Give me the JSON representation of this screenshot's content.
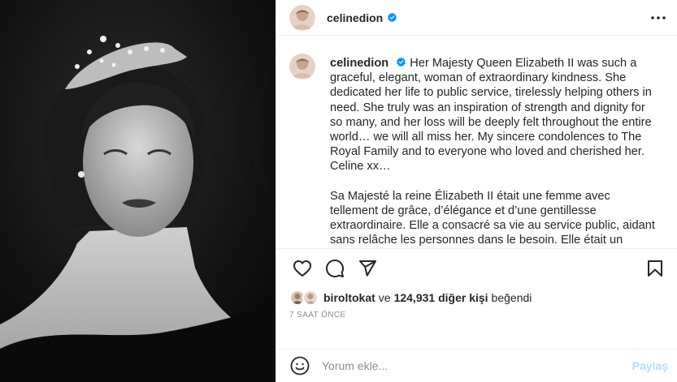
{
  "post": {
    "image_alt": "Black and white portrait of a woman wearing a diamond tiara"
  },
  "header": {
    "username": "celinedion",
    "verified_icon": "verified-badge-icon",
    "more_icon": "more-options-icon"
  },
  "caption": {
    "author": "celinedion",
    "paragraph_en": "Her Majesty Queen Elizabeth II was such a graceful, elegant, woman of extraordinary kindness. She dedicated her life to public service, tirelessly helping others in need. She truly was an inspiration of strength and dignity for so many, and her loss will be deeply felt throughout the entire world… we will all miss her. My sincere condolences to The Royal Family and to everyone who loved and cherished her. Celine xx…",
    "paragraph_fr": "Sa Majesté la reine Élizabeth II était une femme avec tellement de grâce, d’élégance et d’une gentillesse extraordinaire. Elle a consacré sa vie au service public, aidant sans relâche les personnes dans le besoin. Elle était un modèle de force et de"
  },
  "actions": {
    "icons": [
      "heart-icon",
      "comment-icon",
      "share-icon",
      "bookmark-icon"
    ]
  },
  "likes": {
    "first_user": "biroltokat",
    "connector": "ve",
    "others": "124,931 diğer kişi",
    "suffix": "beğendi"
  },
  "timestamp": "7 SAAT ÖNCE",
  "comment": {
    "placeholder": "Yorum ekle...",
    "post_label": "Paylaş",
    "emoji_icon": "emoji-icon"
  },
  "colors": {
    "text": "#262626",
    "muted": "#8e8e8e",
    "verified": "#0095f6",
    "post_button_disabled": "#b2dffc",
    "border": "#efefef"
  }
}
